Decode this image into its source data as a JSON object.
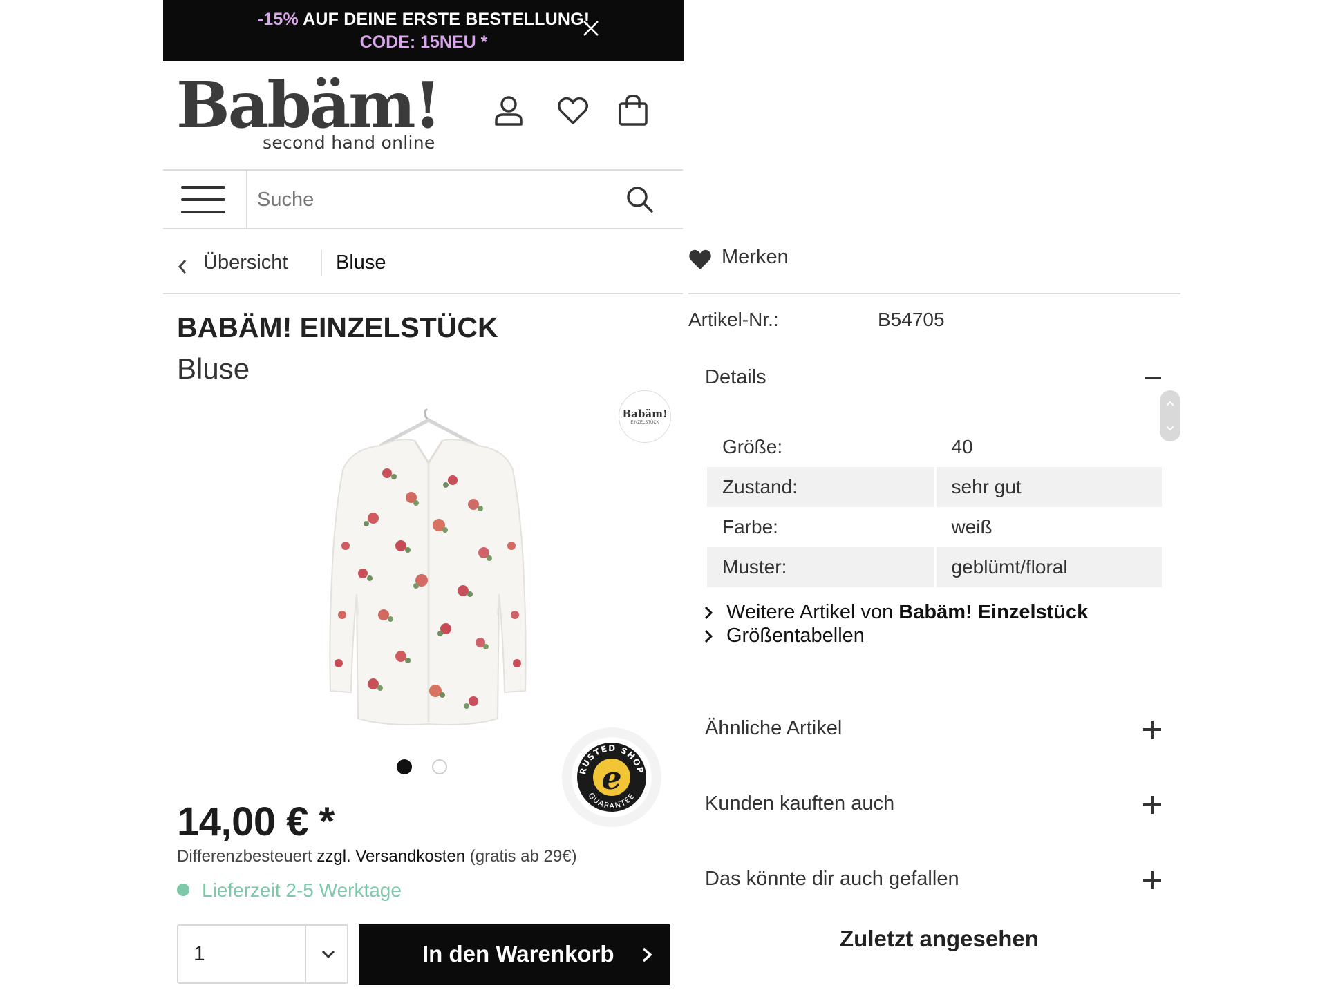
{
  "promo": {
    "line1_prefix": "-15%",
    "line1_rest": " AUF DEINE ERSTE BESTELLUNG!",
    "line2": "CODE: 15NEU *"
  },
  "header": {
    "logo_word": "Babäm!",
    "logo_sub": "second hand online",
    "icons": [
      "account-icon",
      "wishlist-icon",
      "cart-icon"
    ]
  },
  "search": {
    "placeholder": "Suche"
  },
  "breadcrumb": {
    "back": "Übersicht",
    "current": "Bluse"
  },
  "product": {
    "brand": "BABÄM! EINZELSTÜCK",
    "type": "Bluse",
    "badge_word": "Babäm!",
    "badge_sub": "EINZELSTÜCK",
    "price": "14,00 € *",
    "tax_prefix": "Differenzbesteuert ",
    "tax_shipping": "zzgl. Versandkosten",
    "tax_free": " (gratis ab 29€)",
    "delivery": "Lieferzeit 2-5 Werktage",
    "quantity": "1",
    "cart_button": "In den Warenkorb",
    "image_count": 2,
    "active_image": 1
  },
  "trust_badge": {
    "top_text": "TRUSTED SHOPS",
    "bottom_text": "GUARANTEE",
    "letter": "e"
  },
  "wishlist": {
    "label": "Merken"
  },
  "article": {
    "label": "Artikel-Nr.:",
    "value": "B54705"
  },
  "details": {
    "heading": "Details",
    "rows": [
      {
        "key": "Größe:",
        "value": "40"
      },
      {
        "key": "Zustand:",
        "value": "sehr gut"
      },
      {
        "key": "Farbe:",
        "value": "weiß"
      },
      {
        "key": "Muster:",
        "value": "geblümt/floral"
      }
    ],
    "more_prefix": "Weitere Artikel von ",
    "more_brand": "Babäm! Einzelstück",
    "size_tables": "Größentabellen"
  },
  "accordions": [
    "Ähnliche Artikel",
    "Kunden kauften auch",
    "Das könnte dir auch gefallen"
  ],
  "recently_viewed": "Zuletzt angesehen",
  "colors": {
    "banner": "#0b0b0b",
    "promo_accent": "#d9a8ea",
    "delivery": "#7cc8a8",
    "button": "#0b0b0b"
  }
}
